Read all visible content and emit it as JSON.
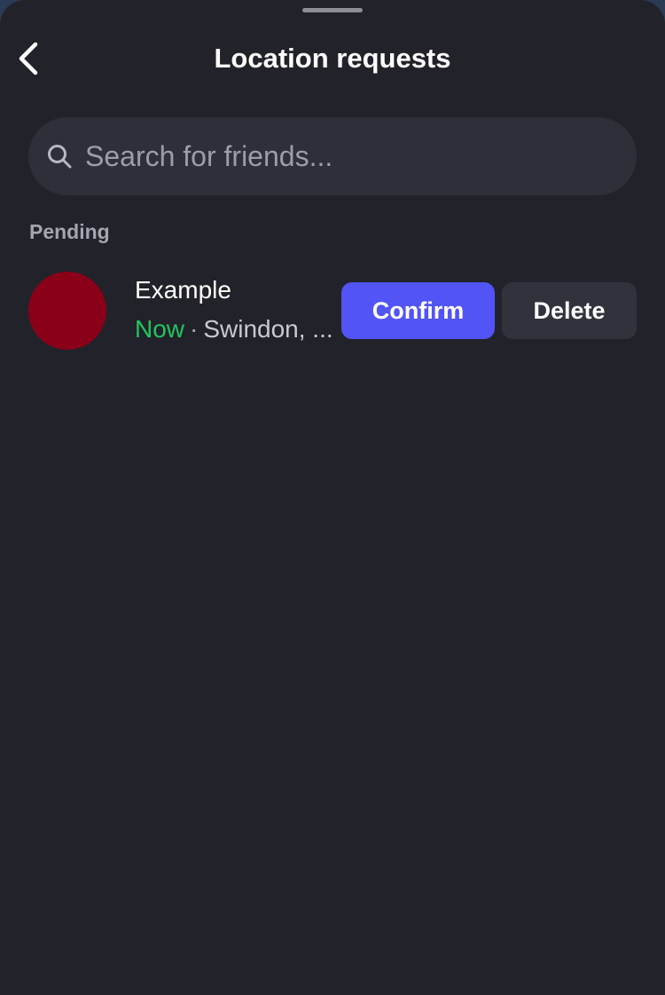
{
  "header": {
    "title": "Location requests",
    "back_icon": "chevron-left-icon"
  },
  "search": {
    "placeholder": "Search for friends...",
    "value": "",
    "icon": "search-icon"
  },
  "sections": {
    "pending_label": "Pending"
  },
  "requests": [
    {
      "name": "Example",
      "status": "Now",
      "separator": "·",
      "location": "Swindon, ...",
      "avatar_color": "#8a0018",
      "confirm_label": "Confirm",
      "delete_label": "Delete"
    }
  ],
  "colors": {
    "accent": "#5254f5",
    "status_now": "#22c55e",
    "background": "#22232a"
  }
}
